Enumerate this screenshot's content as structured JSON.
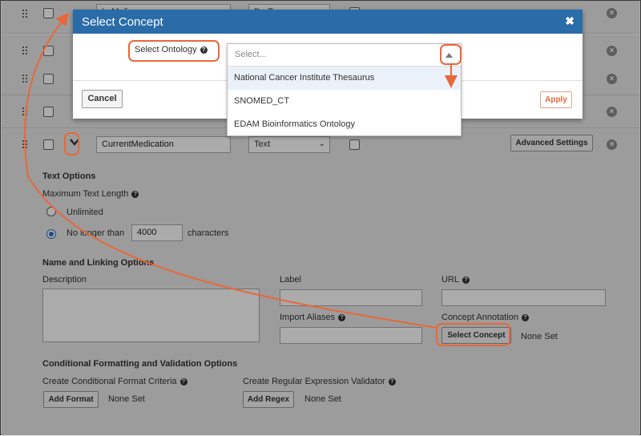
{
  "rows": {
    "partial_field_name": "I...M.di...",
    "partial_type": "D...T...",
    "current": {
      "field_name": "CurrentMedication",
      "type": "Text",
      "advanced_label": "Advanced Settings"
    }
  },
  "text_options": {
    "heading": "Text Options",
    "max_length_label": "Maximum Text Length",
    "unlimited_label": "Unlimited",
    "longer_label": "No longer than",
    "length_value": "4000",
    "characters_label": "characters"
  },
  "name_linking": {
    "heading": "Name and Linking Options",
    "description_label": "Description",
    "label_label": "Label",
    "url_label": "URL",
    "import_aliases_label": "Import Aliases",
    "concept_annotation_label": "Concept Annotation",
    "select_concept_label": "Select Concept",
    "concept_value": "None Set"
  },
  "conditional": {
    "heading": "Conditional Formatting and Validation Options",
    "format_label": "Create Conditional Format Criteria",
    "add_format_label": "Add Format",
    "format_value": "None Set",
    "regex_label": "Create Regular Expression Validator",
    "add_regex_label": "Add Regex",
    "regex_value": "None Set"
  },
  "modal": {
    "title": "Select Concept",
    "close_glyph": "✖",
    "ontology_label": "Select Ontology",
    "cancel_label": "Cancel",
    "apply_label": "Apply",
    "placeholder": "Select...",
    "options": [
      "National Cancer Institute Thesaurus",
      "SNOMED_CT",
      "EDAM Bioinformatics Ontology"
    ]
  },
  "colors": {
    "header": "#2a6ca8",
    "highlight": "#e8683a",
    "apply_text": "#e8683a"
  }
}
